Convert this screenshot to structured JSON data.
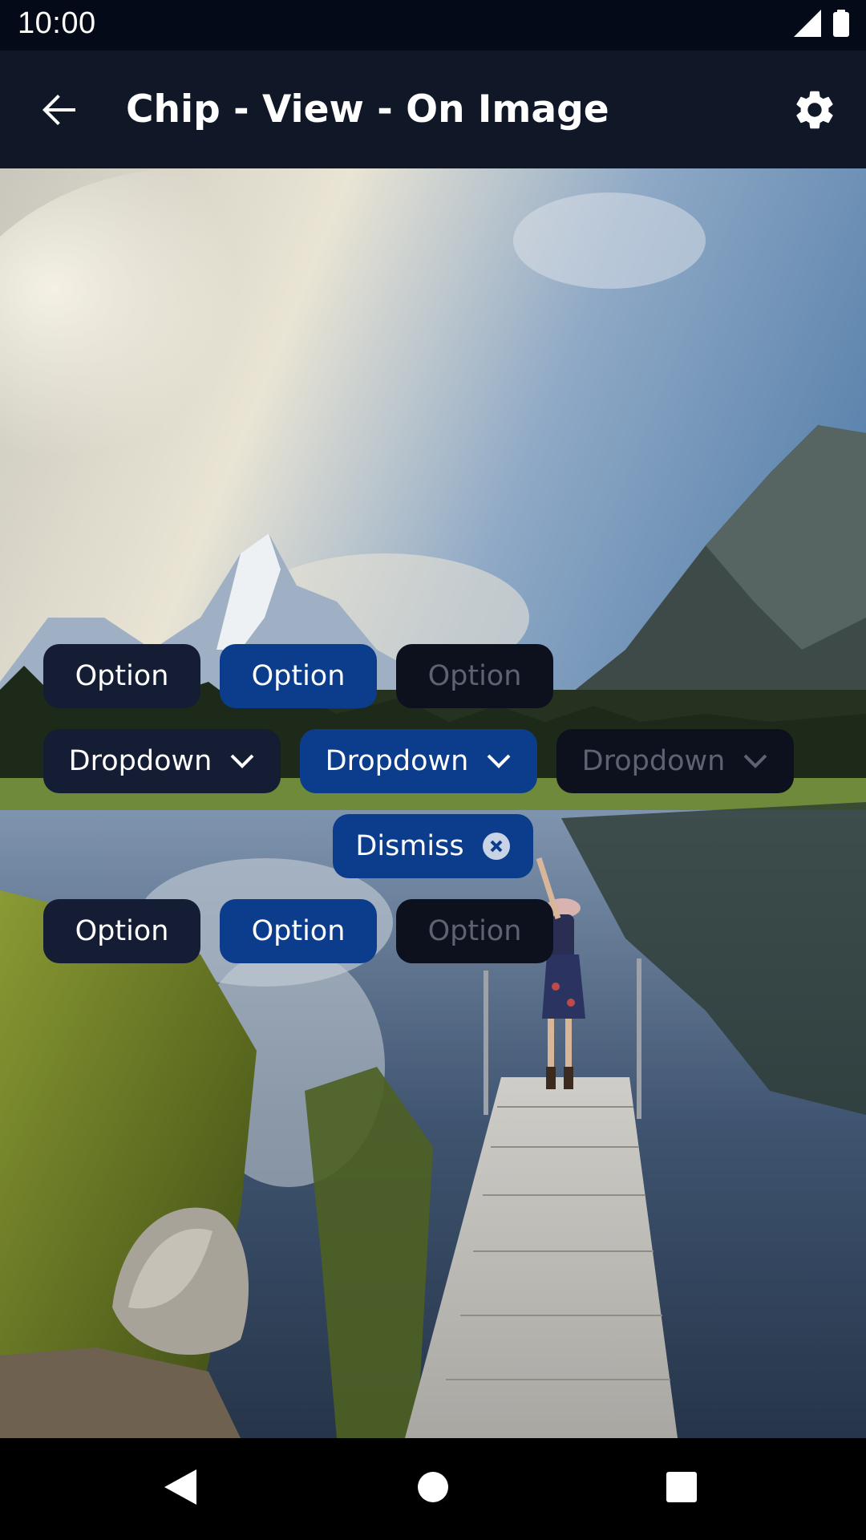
{
  "status_bar": {
    "time": "10:00",
    "icons": [
      "signal-icon",
      "battery-icon"
    ]
  },
  "app_bar": {
    "title": "Chip - View - On Image",
    "back_icon": "arrow-back-icon",
    "settings_icon": "gear-icon"
  },
  "chips": {
    "row1": [
      {
        "label": "Option",
        "state": "default"
      },
      {
        "label": "Option",
        "state": "selected"
      },
      {
        "label": "Option",
        "state": "disabled"
      }
    ],
    "row2": [
      {
        "label": "Dropdown",
        "state": "default",
        "icon": "chevron-down-icon"
      },
      {
        "label": "Dropdown",
        "state": "selected",
        "icon": "chevron-down-icon"
      },
      {
        "label": "Dropdown",
        "state": "disabled",
        "icon": "chevron-down-icon"
      }
    ],
    "row3": [
      {
        "label": "Dismiss",
        "state": "selected",
        "icon": "close-circle-icon"
      }
    ],
    "row4": [
      {
        "label": "Option",
        "state": "default"
      },
      {
        "label": "Option",
        "state": "selected"
      },
      {
        "label": "Option",
        "state": "disabled"
      }
    ]
  },
  "nav_bar": {
    "icons": [
      "nav-back-icon",
      "nav-home-icon",
      "nav-recents-icon"
    ]
  },
  "colors": {
    "status_bar": "#050a18",
    "app_bar": "#101828",
    "chip_default": "#141d33",
    "chip_selected": "#0b3d8c",
    "chip_disabled": "#0d111d",
    "chip_disabled_text": "#5d6372"
  }
}
